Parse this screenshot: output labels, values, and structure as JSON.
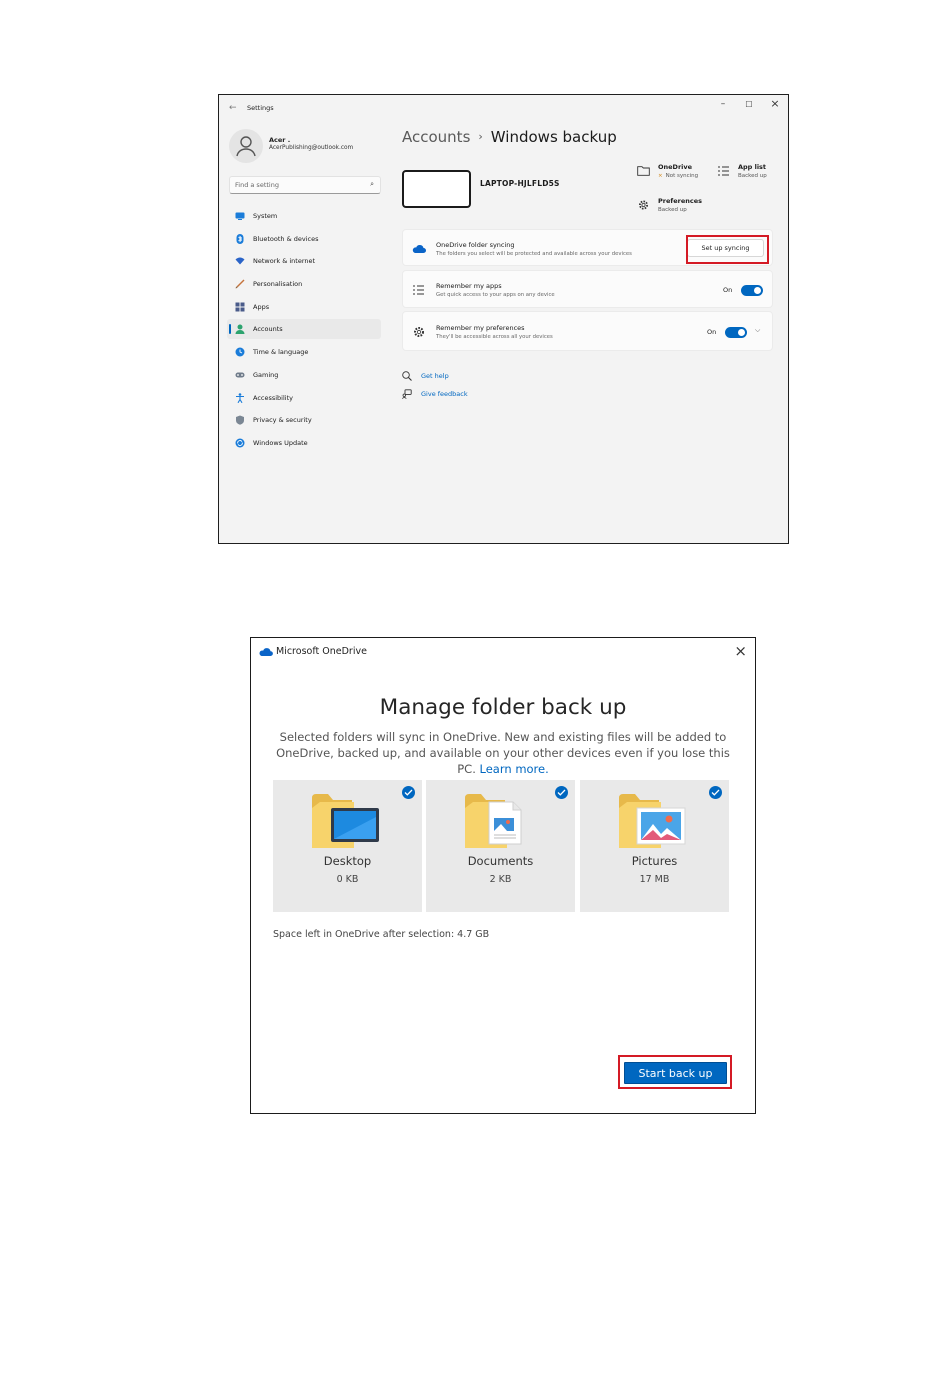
{
  "settings": {
    "title": "Settings",
    "window_controls": {
      "minimize": "–",
      "maximize": "☐",
      "close": "×"
    },
    "profile": {
      "name": "Acer .",
      "email": "AcerPublishing@outlook.com"
    },
    "search": {
      "placeholder": "Find a setting"
    },
    "nav": [
      {
        "label": "System",
        "color": "#1a7cd9"
      },
      {
        "label": "Bluetooth & devices",
        "color": "#1a7cd9"
      },
      {
        "label": "Network & internet",
        "color": "#2a64c8"
      },
      {
        "label": "Personalisation",
        "color": "#c5733b"
      },
      {
        "label": "Apps",
        "color": "#4a5b8a"
      },
      {
        "label": "Accounts",
        "color": "#2ca36e",
        "active": true
      },
      {
        "label": "Time & language",
        "color": "#1a7cd9"
      },
      {
        "label": "Gaming",
        "color": "#6f7b8a"
      },
      {
        "label": "Accessibility",
        "color": "#1a7cd9"
      },
      {
        "label": "Privacy & security",
        "color": "#7b8794"
      },
      {
        "label": "Windows Update",
        "color": "#1a7cd9"
      }
    ],
    "breadcrumb": {
      "parent": "Accounts",
      "separator": "›",
      "current": "Windows backup"
    },
    "device": {
      "name": "LAPTOP-HJLFLD5S"
    },
    "status": {
      "onedrive": {
        "title": "OneDrive",
        "status": "Not syncing",
        "status_marker": "×"
      },
      "app_list": {
        "title": "App list",
        "status": "Backed up"
      },
      "preferences": {
        "title": "Preferences",
        "status": "Backed up"
      }
    },
    "cards": {
      "onedrive_sync": {
        "title": "OneDrive folder syncing",
        "subtitle": "The folders you select will be protected and available across your devices",
        "button": "Set up syncing"
      },
      "remember_apps": {
        "title": "Remember my apps",
        "subtitle": "Get quick access to your apps on any device",
        "toggle_label": "On",
        "toggle_on": true
      },
      "remember_prefs": {
        "title": "Remember my preferences",
        "subtitle": "They'll be accessible across all your devices",
        "toggle_label": "On",
        "toggle_on": true
      }
    },
    "links": {
      "help": "Get help",
      "feedback": "Give feedback"
    },
    "accent": "#0067c0"
  },
  "onedrive": {
    "app_title": "Microsoft OneDrive",
    "close": "×",
    "heading": "Manage folder back up",
    "description": "Selected folders will sync in OneDrive. New and existing files will be added to OneDrive, backed up, and available on your other devices even if you lose this PC.",
    "learn_more": "Learn more.",
    "folders": [
      {
        "name": "Desktop",
        "size": "0 KB",
        "checked": true
      },
      {
        "name": "Documents",
        "size": "2 KB",
        "checked": true
      },
      {
        "name": "Pictures",
        "size": "17 MB",
        "checked": true
      }
    ],
    "space_left": "Space left in OneDrive after selection: 4.7 GB",
    "start_button": "Start back up",
    "highlight_color": "#d41a25"
  }
}
